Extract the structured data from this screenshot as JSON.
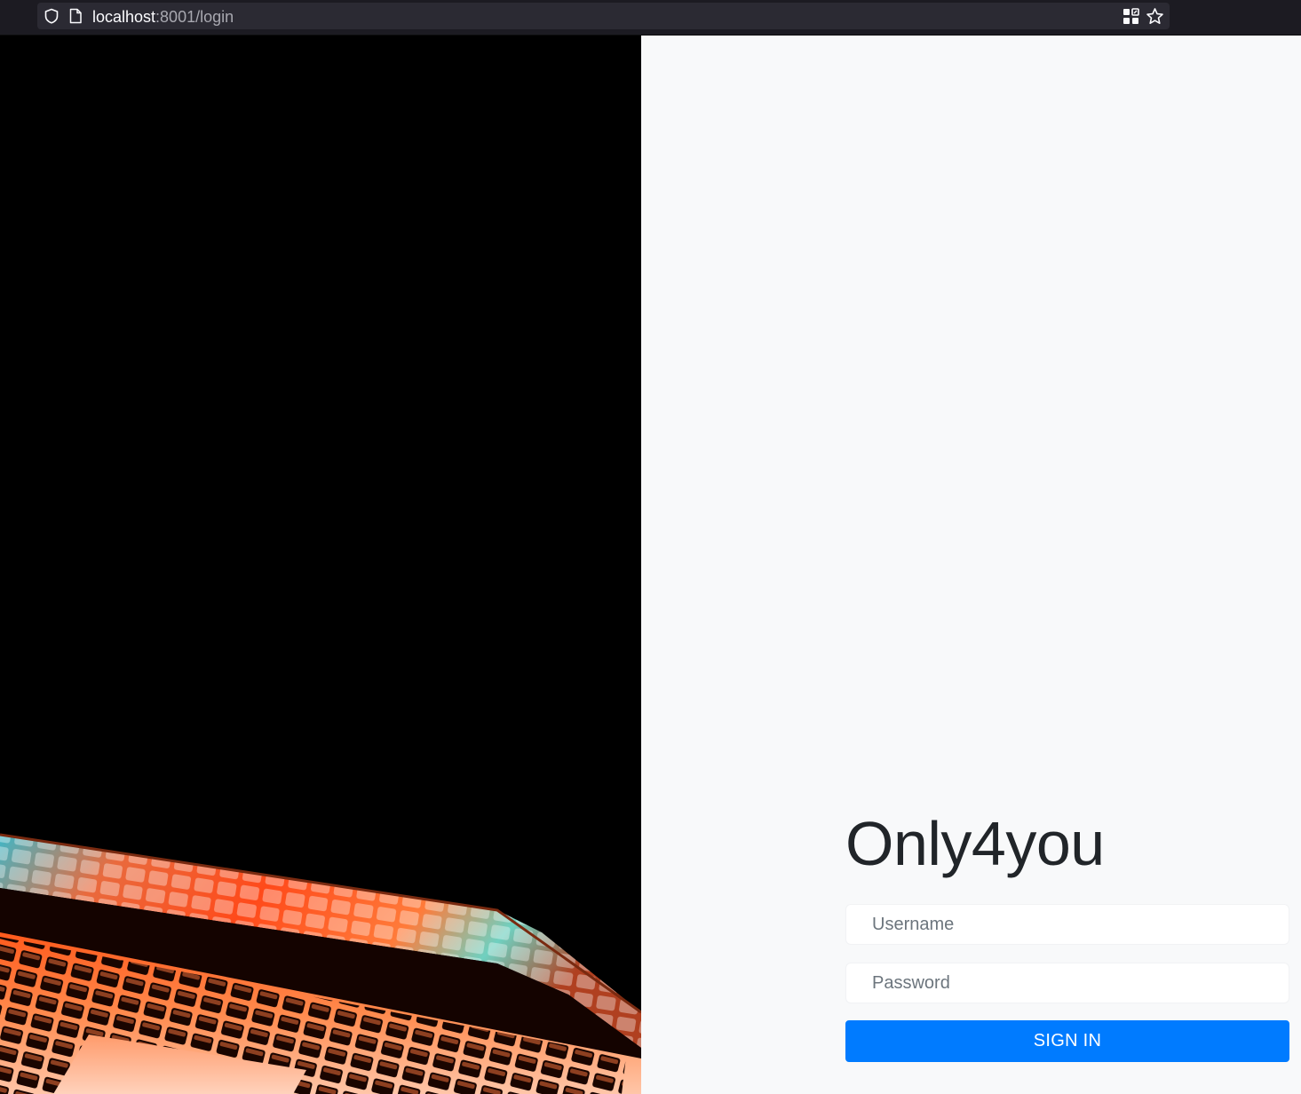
{
  "browser": {
    "url_host": "localhost",
    "url_rest": ":8001/login",
    "icons": [
      "shield-icon",
      "page-icon",
      "qr-code-icon",
      "bookmark-star-icon"
    ]
  },
  "hero": {
    "image": "laptop-keyboard-glow",
    "colors": {
      "background": "#000000",
      "glow": "#ff5a1f"
    }
  },
  "login": {
    "brand": "Only4you",
    "username_placeholder": "Username",
    "password_placeholder": "Password",
    "signin_label": "SIGN IN"
  },
  "colors": {
    "accent": "#007bff",
    "panel_bg": "#f8f9fa"
  }
}
